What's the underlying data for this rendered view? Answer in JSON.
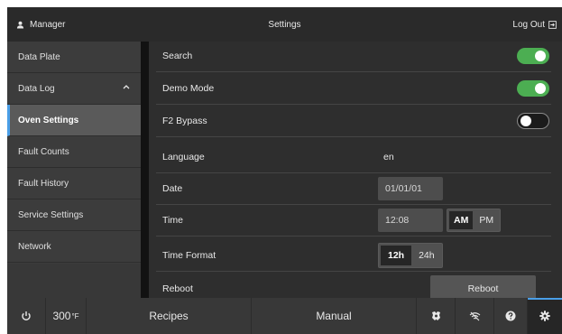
{
  "header": {
    "user_label": "Manager",
    "title": "Settings",
    "logout_label": "Log Out"
  },
  "sidebar": {
    "items": [
      {
        "label": "Data Plate"
      },
      {
        "label": "Data Log",
        "icon": "chevron-up-icon"
      },
      {
        "label": "Oven Settings",
        "active": true
      },
      {
        "label": "Fault Counts"
      },
      {
        "label": "Fault History"
      },
      {
        "label": "Service Settings"
      },
      {
        "label": "Network"
      }
    ]
  },
  "settings": {
    "search": {
      "label": "Search",
      "state": "on"
    },
    "demo_mode": {
      "label": "Demo Mode",
      "state": "on"
    },
    "f2_bypass": {
      "label": "F2 Bypass",
      "state": "off"
    },
    "language": {
      "label": "Language",
      "value": "en"
    },
    "date": {
      "label": "Date",
      "value": "01/01/01"
    },
    "time": {
      "label": "Time",
      "value": "12:08",
      "am_label": "AM",
      "pm_label": "PM",
      "selected": "AM"
    },
    "time_format": {
      "label": "Time Format",
      "opt_12": "12h",
      "opt_24": "24h",
      "selected": "12h"
    },
    "reboot": {
      "label": "Reboot",
      "button_label": "Reboot"
    }
  },
  "bottombar": {
    "temperature": "300",
    "temp_unit": "°F",
    "recipes_label": "Recipes",
    "manual_label": "Manual",
    "icons": [
      "power-icon",
      "cleaning-icon",
      "wifi-off-icon",
      "help-icon",
      "gear-icon"
    ]
  },
  "colors": {
    "accent": "#4a9fe8",
    "toggle_on": "#4cae52",
    "background": "#2e2e2e"
  }
}
